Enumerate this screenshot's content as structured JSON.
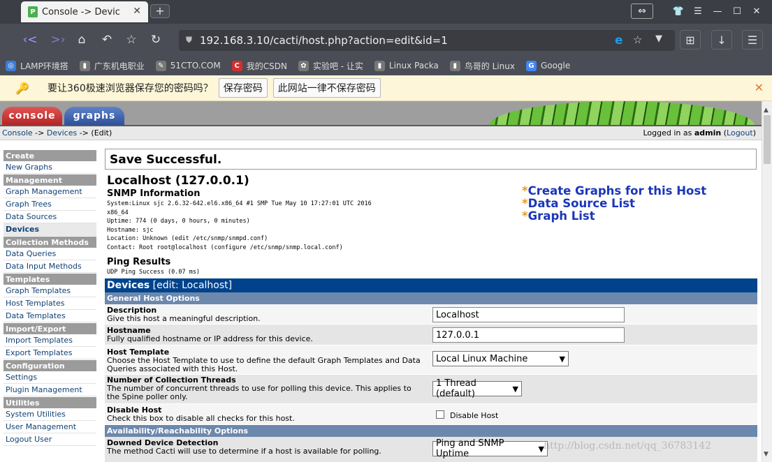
{
  "browser": {
    "tab_title": "Console -> Devices",
    "tab_close": "✕",
    "new_tab": "+",
    "url": "192.168.3.10/cacti/host.php?action=edit&id=1",
    "bookmarks": [
      {
        "label": "LAMP环境搭",
        "color": "#3b7dd8",
        "glyph": "◎"
      },
      {
        "label": "广东机电职业",
        "color": "#777777",
        "glyph": "▮"
      },
      {
        "label": "51CTO.COM",
        "color": "#777777",
        "glyph": "✎"
      },
      {
        "label": "我的CSDN",
        "color": "#d32f2f",
        "glyph": "C"
      },
      {
        "label": "实验吧 - 让实",
        "color": "#777777",
        "glyph": "✿"
      },
      {
        "label": "Linux Packa",
        "color": "#777777",
        "glyph": "▮"
      },
      {
        "label": "鸟哥的 Linux",
        "color": "#777777",
        "glyph": "▮"
      },
      {
        "label": "Google",
        "color": "#4285f4",
        "glyph": "G"
      }
    ],
    "password_prompt": {
      "text": "要让360极速浏览器保存您的密码吗？",
      "save_label": "保存密码",
      "never_label": "此网站一律不保存密码"
    }
  },
  "cacti": {
    "tabs": {
      "console": "console",
      "graphs": "graphs"
    },
    "breadcrumb": {
      "console": "Console",
      "sep1": " -> ",
      "devices": "Devices",
      "sep2": " -> ",
      "current": "(Edit)"
    },
    "login": {
      "prefix": "Logged in as ",
      "user": "admin",
      "open": " (",
      "logout": "Logout",
      "close": ")"
    },
    "sidebar": [
      {
        "type": "header",
        "label": "Create"
      },
      {
        "type": "item",
        "label": "New Graphs"
      },
      {
        "type": "header",
        "label": "Management"
      },
      {
        "type": "item",
        "label": "Graph Management"
      },
      {
        "type": "item",
        "label": "Graph Trees"
      },
      {
        "type": "item",
        "label": "Data Sources"
      },
      {
        "type": "item",
        "label": "Devices",
        "active": true
      },
      {
        "type": "header",
        "label": "Collection Methods"
      },
      {
        "type": "item",
        "label": "Data Queries"
      },
      {
        "type": "item",
        "label": "Data Input Methods"
      },
      {
        "type": "header",
        "label": "Templates"
      },
      {
        "type": "item",
        "label": "Graph Templates"
      },
      {
        "type": "item",
        "label": "Host Templates"
      },
      {
        "type": "item",
        "label": "Data Templates"
      },
      {
        "type": "header",
        "label": "Import/Export"
      },
      {
        "type": "item",
        "label": "Import Templates"
      },
      {
        "type": "item",
        "label": "Export Templates"
      },
      {
        "type": "header",
        "label": "Configuration"
      },
      {
        "type": "item",
        "label": "Settings"
      },
      {
        "type": "item",
        "label": "Plugin Management"
      },
      {
        "type": "header",
        "label": "Utilities"
      },
      {
        "type": "item",
        "label": "System Utilities"
      },
      {
        "type": "item",
        "label": "User Management"
      },
      {
        "type": "item",
        "label": "Logout User"
      }
    ],
    "save_message": "Save Successful.",
    "host": {
      "title": "Localhost (127.0.0.1)",
      "snmp_heading": "SNMP Information",
      "snmp_lines": [
        "System:Linux sjc 2.6.32-642.el6.x86_64 #1 SMP Tue May 10 17:27:01 UTC 2016",
        "x86_64",
        "Uptime: 774 (0 days, 0 hours, 0 minutes)",
        "Hostname: sjc",
        "Location: Unknown (edit /etc/snmp/snmpd.conf)",
        "Contact: Root root@localhost (configure /etc/snmp/snmp.local.conf)"
      ],
      "ping_heading": "Ping Results",
      "ping_result": "UDP Ping Success (0.07 ms)",
      "links": [
        "Create Graphs for this Host",
        "Data Source List",
        "Graph List"
      ]
    },
    "form": {
      "title": "Devices",
      "title_suffix": "[edit: Localhost]",
      "group1": "General Host Options",
      "description": {
        "label": "Description",
        "help": "Give this host a meaningful description.",
        "value": "Localhost"
      },
      "hostname": {
        "label": "Hostname",
        "help": "Fully qualified hostname or IP address for this device.",
        "value": "127.0.0.1"
      },
      "host_template": {
        "label": "Host Template",
        "help": "Choose the Host Template to use to define the default Graph Templates and Data Queries associated with this Host.",
        "value": "Local Linux Machine"
      },
      "threads": {
        "label": "Number of Collection Threads",
        "help": "The number of concurrent threads to use for polling this device. This applies to the Spine poller only.",
        "value": "1 Thread (default)"
      },
      "disable": {
        "label": "Disable Host",
        "help": "Check this box to disable all checks for this host.",
        "checkbox_label": "Disable Host"
      },
      "group2": "Availability/Reachability Options",
      "downed": {
        "label": "Downed Device Detection",
        "help": "The method Cacti will use to determine if a host is available for polling.",
        "value": "Ping and SNMP Uptime"
      }
    },
    "watermark": "http://blog.csdn.net/qq_36783142"
  }
}
